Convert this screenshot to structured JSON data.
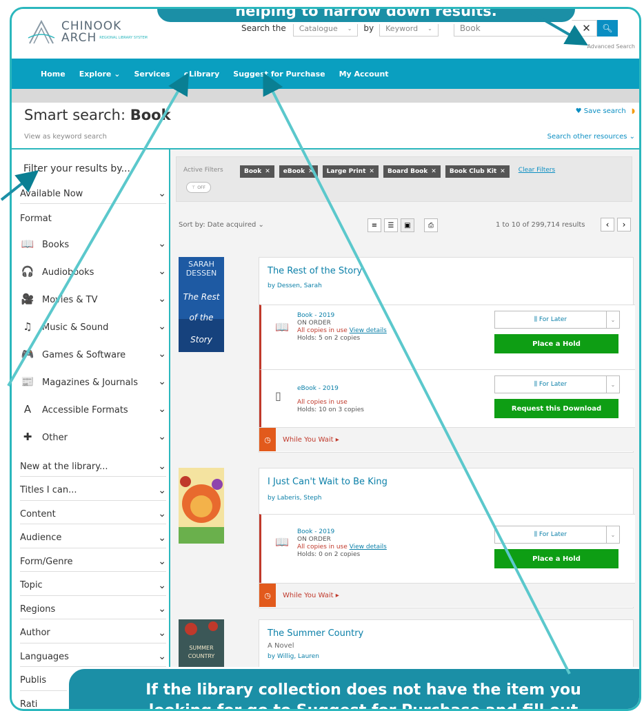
{
  "annotations": {
    "top": "helping to narrow down results.",
    "bottom_line1": "If the library collection does not have the item you",
    "bottom_line2": "looking for go to Suggest for Purchase and fill out"
  },
  "header": {
    "logo_line1": "CHINOOK",
    "logo_line2": "ARCH",
    "logo_small": "REGIONAL LIBRARY SYSTEM",
    "search_the": "Search the",
    "catalogue": "Catalogue",
    "by": "by",
    "keyword": "Keyword",
    "query": "Book",
    "advanced": "Advanced Search"
  },
  "nav": [
    "Home",
    "Explore ⌄",
    "Services",
    "eLibrary",
    "Suggest for Purchase",
    "My Account"
  ],
  "page": {
    "title_prefix": "Smart search: ",
    "title_query": "Book",
    "keyword_link": "View as keyword search",
    "save_search": "♥ Save search",
    "other_resources": "Search other resources ⌄"
  },
  "sidebar": {
    "heading": "Filter your results by...",
    "available": "Available Now",
    "format_heading": "Format",
    "formats": [
      {
        "label": "Books",
        "icon": "book-icon",
        "glyph": "📖"
      },
      {
        "label": "Audiobooks",
        "icon": "headphones-icon",
        "glyph": "🎧"
      },
      {
        "label": "Movies & TV",
        "icon": "video-camera-icon",
        "glyph": "🎥"
      },
      {
        "label": "Music & Sound",
        "icon": "music-note-icon",
        "glyph": "♫"
      },
      {
        "label": "Games & Software",
        "icon": "gamepad-icon",
        "glyph": "🎮"
      },
      {
        "label": "Magazines & Journals",
        "icon": "newspaper-icon",
        "glyph": "📰"
      },
      {
        "label": "Accessible Formats",
        "icon": "letter-a-icon",
        "glyph": "A"
      },
      {
        "label": "Other",
        "icon": "plus-icon",
        "glyph": "✚"
      }
    ],
    "groups": [
      "New at the library...",
      "Titles I can...",
      "Content",
      "Audience",
      "Form/Genre",
      "Topic",
      "Regions",
      "Author",
      "Languages",
      "Publis",
      "Rati"
    ]
  },
  "filters": {
    "label": "Active Filters",
    "toggle": "OFF",
    "chips": [
      "Book",
      "eBook",
      "Large Print",
      "Board Book",
      "Book Club Kit"
    ],
    "clear": "Clear Filters"
  },
  "results_bar": {
    "sort": "Sort by: Date acquired ⌄",
    "count": "1 to 10 of 299,714 results"
  },
  "results": [
    {
      "title": "The Rest of the Story",
      "author": "by Dessen, Sarah",
      "cover_text": [
        "SARAH",
        "DESSEN",
        "The Rest",
        "of the",
        "Story"
      ],
      "items": [
        {
          "type": "Book - 2019",
          "status": "ON ORDER",
          "avail": "All copies in use ",
          "details": "View details",
          "holds": "Holds: 5 on 2 copies",
          "later": "For Later",
          "action": "Place a Hold"
        },
        {
          "type": "eBook - 2019",
          "status": "",
          "avail": "All copies in use",
          "details": "",
          "holds": "Holds: 10 on 3 copies",
          "later": "For Later",
          "action": "Request this Download"
        }
      ],
      "wait": "While You Wait ▸"
    },
    {
      "title": "I Just Can't Wait to Be King",
      "author": "by Laberis, Steph",
      "items": [
        {
          "type": "Book - 2019",
          "status": "ON ORDER",
          "avail": "All copies in use ",
          "details": "View details",
          "holds": "Holds: 0 on 2 copies",
          "later": "For Later",
          "action": "Place a Hold"
        }
      ],
      "wait": "While You Wait ▸"
    },
    {
      "title": "The Summer Country",
      "subtitle": "A Novel",
      "author": "by Willig, Lauren",
      "cover_text": [
        "SUMMER",
        "COUNTRY"
      ]
    }
  ],
  "colors": {
    "accent": "#2bb7bd",
    "nav": "#0a9fc0",
    "hold": "#0e9e14",
    "wait": "#e25a1c"
  }
}
